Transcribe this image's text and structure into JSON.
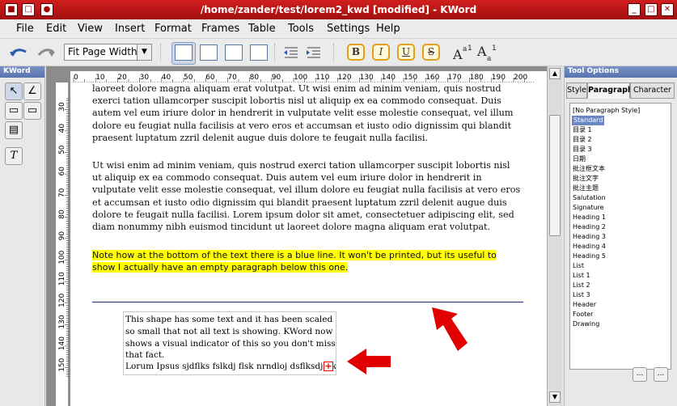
{
  "window": {
    "title": "/home/zander/test/lorem2_kwd [modified] - KWord"
  },
  "menubar": {
    "items": [
      "File",
      "Edit",
      "View",
      "Insert",
      "Format",
      "Frames",
      "Table",
      "Tools",
      "Settings",
      "Help"
    ]
  },
  "toolbar": {
    "zoom_value": "Fit Page Width",
    "format_buttons": [
      "B",
      "I",
      "U",
      "S"
    ]
  },
  "left_panel": {
    "title": "KWord"
  },
  "document": {
    "ruler_labels": [
      "0",
      "10",
      "20",
      "30",
      "40",
      "50",
      "60",
      "70",
      "80",
      "90",
      "100",
      "110",
      "120",
      "130",
      "140",
      "150",
      "160",
      "170",
      "180",
      "190",
      "200"
    ],
    "vruler_labels": [
      "30",
      "40",
      "50",
      "60",
      "70",
      "80",
      "90",
      "100",
      "110",
      "120",
      "130",
      "140",
      "150"
    ],
    "paragraphs": [
      "laoreet dolore magna aliquam erat volutpat. Ut wisi enim ad minim veniam, quis nostrud exerci tation ullamcorper suscipit lobortis nisl ut aliquip ex ea commodo consequat. Duis autem vel eum iriure dolor in hendrerit in vulputate velit esse molestie consequat, vel illum dolore eu feugiat nulla facilisis at vero eros et accumsan et iusto odio dignissim qui blandit praesent luptatum zzril delenit augue duis dolore te feugait nulla facilisi.",
      "Ut wisi enim ad minim veniam, quis nostrud exerci tation ullamcorper suscipit lobortis nisl ut aliquip ex ea commodo consequat. Duis autem vel eum iriure dolor in hendrerit in vulputate velit esse molestie consequat, vel illum dolore eu feugiat nulla facilisis at vero eros et accumsan et iusto odio dignissim qui blandit praesent luptatum zzril delenit augue duis dolore te feugait nulla facilisi. Lorem ipsum dolor sit amet, consectetuer adipiscing elit, sed diam nonummy nibh euismod tincidunt ut laoreet dolore magna aliquam erat volutpat."
    ],
    "highlight_text": "Note how at the bottom of the text there is a blue line.  It won't be printed, but its useful to show I actually have an empty paragraph below this one.",
    "shape_text": "This shape has some text and it has been scaled so small that not all text is showing. KWord now shows a visual indicator of this so you don't miss that fact.",
    "shape_text_2": "Lorum Ipsus sjdflks fslkdj flsk nrndloj dsflksdj flk"
  },
  "right_panel": {
    "title": "Tool Options",
    "tabs": [
      "Style",
      "Paragraph",
      "Character"
    ],
    "styles": [
      "[No Paragraph Style]",
      "Standard",
      "目录 1",
      "目录 2",
      "目录 3",
      "日期",
      "批注框文本",
      "批注文字",
      "批注主题",
      "Salutation",
      "Signature",
      "Heading 1",
      "Heading 2",
      "Heading 3",
      "Heading 4",
      "Heading 5",
      "List",
      "List 1",
      "List 2",
      "List 3",
      "Header",
      "Footer",
      "Drawing"
    ],
    "button_label": "..."
  },
  "colors": {
    "titlebar": "#b81818",
    "highlight": "#ffff00",
    "blue_line": "#1a2a80",
    "arrow": "#e00000",
    "selection": "#6a87c4"
  }
}
